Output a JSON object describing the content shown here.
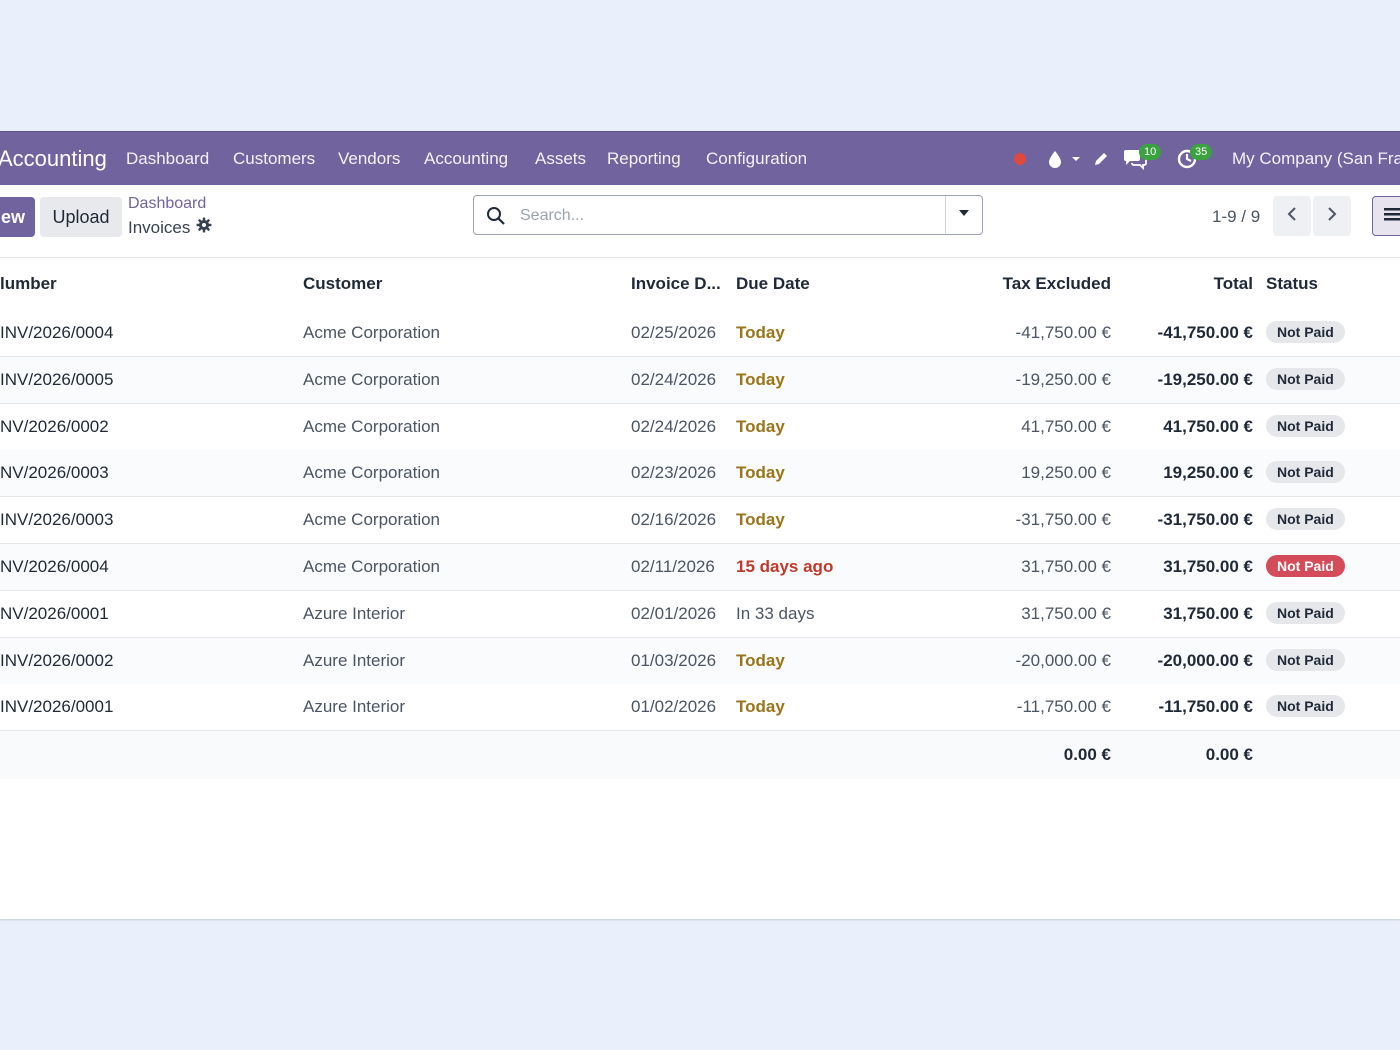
{
  "navbar": {
    "app_name": "Accounting",
    "menu": [
      "Dashboard",
      "Customers",
      "Vendors",
      "Accounting",
      "Assets",
      "Reporting",
      "Configuration"
    ],
    "messages_count": "10",
    "activities_count": "35",
    "company": "My Company (San Fra"
  },
  "control_panel": {
    "new_label": "ew",
    "upload_label": "Upload",
    "breadcrumb_parent": "Dashboard",
    "breadcrumb_current": "Invoices",
    "search_placeholder": "Search...",
    "pager_value": "1-9 / 9"
  },
  "table": {
    "headers": {
      "number": "lumber",
      "customer": "Customer",
      "invoice_date": "Invoice D...",
      "due_date": "Due Date",
      "tax_excluded": "Tax Excluded",
      "total": "Total",
      "status": "Status"
    },
    "rows": [
      {
        "number": "INV/2026/0004",
        "customer": "Acme Corporation",
        "invoice_date": "02/25/2026",
        "due": "Today",
        "due_state": "warning",
        "tax_excluded": "-41,750.00 €",
        "total": "-41,750.00 €",
        "status": "Not Paid",
        "status_state": "default"
      },
      {
        "number": "INV/2026/0005",
        "customer": "Acme Corporation",
        "invoice_date": "02/24/2026",
        "due": "Today",
        "due_state": "warning",
        "tax_excluded": "-19,250.00 €",
        "total": "-19,250.00 €",
        "status": "Not Paid",
        "status_state": "default"
      },
      {
        "number": "NV/2026/0002",
        "customer": "Acme Corporation",
        "invoice_date": "02/24/2026",
        "due": "Today",
        "due_state": "warning",
        "tax_excluded": "41,750.00 €",
        "total": "41,750.00 €",
        "status": "Not Paid",
        "status_state": "default"
      },
      {
        "number": "NV/2026/0003",
        "customer": "Acme Corporation",
        "invoice_date": "02/23/2026",
        "due": "Today",
        "due_state": "warning",
        "tax_excluded": "19,250.00 €",
        "total": "19,250.00 €",
        "status": "Not Paid",
        "status_state": "default"
      },
      {
        "number": "INV/2026/0003",
        "customer": "Acme Corporation",
        "invoice_date": "02/16/2026",
        "due": "Today",
        "due_state": "warning",
        "tax_excluded": "-31,750.00 €",
        "total": "-31,750.00 €",
        "status": "Not Paid",
        "status_state": "default"
      },
      {
        "number": "NV/2026/0004",
        "customer": "Acme Corporation",
        "invoice_date": "02/11/2026",
        "due": "15 days ago",
        "due_state": "danger",
        "tax_excluded": "31,750.00 €",
        "total": "31,750.00 €",
        "status": "Not Paid",
        "status_state": "danger"
      },
      {
        "number": "NV/2026/0001",
        "customer": "Azure Interior",
        "invoice_date": "02/01/2026",
        "due": "In 33 days",
        "due_state": "normal",
        "tax_excluded": "31,750.00 €",
        "total": "31,750.00 €",
        "status": "Not Paid",
        "status_state": "default"
      },
      {
        "number": "INV/2026/0002",
        "customer": "Azure Interior",
        "invoice_date": "01/03/2026",
        "due": "Today",
        "due_state": "warning",
        "tax_excluded": "-20,000.00 €",
        "total": "-20,000.00 €",
        "status": "Not Paid",
        "status_state": "default"
      },
      {
        "number": "INV/2026/0001",
        "customer": "Azure Interior",
        "invoice_date": "01/02/2026",
        "due": "Today",
        "due_state": "warning",
        "tax_excluded": "-11,750.00 €",
        "total": "-11,750.00 €",
        "status": "Not Paid",
        "status_state": "default"
      }
    ],
    "footer": {
      "tax_excluded": "0.00 €",
      "total": "0.00 €"
    }
  },
  "colors": {
    "brand": "#71639e",
    "due_warning": "#9a7519",
    "due_danger": "#c0392b",
    "due_normal": "#4b5563",
    "badge_danger": "#d44c59",
    "page_background": "#eaf0fb"
  }
}
